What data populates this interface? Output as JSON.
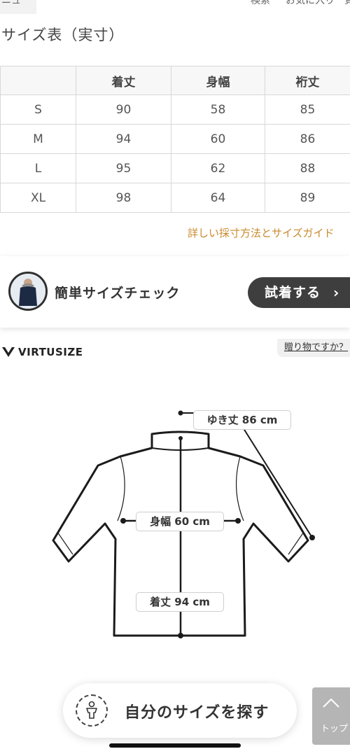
{
  "nav": {
    "left_tab": "ニュー",
    "search": "検索",
    "favorite": "お気に入り一覧"
  },
  "size_chart": {
    "title": "サイズ表（実寸）",
    "columns": [
      "",
      "着丈",
      "身幅",
      "裄丈"
    ],
    "rows": [
      [
        "S",
        "90",
        "58",
        "85"
      ],
      [
        "M",
        "94",
        "60",
        "86"
      ],
      [
        "L",
        "95",
        "62",
        "88"
      ],
      [
        "XL",
        "98",
        "64",
        "89"
      ]
    ],
    "guide_link": "詳しい採寸方法とサイズガイド"
  },
  "size_check": {
    "label": "簡単サイズチェック",
    "try_button": "試着する",
    "chevron": "›"
  },
  "gift_tab": "贈り物ですか？",
  "virtusize": {
    "logo_text": "VIRTUSIZE"
  },
  "diagram": {
    "sleeve_label": "ゆき丈 86 cm",
    "width_label": "身幅 60 cm",
    "length_label": "着丈 94 cm"
  },
  "find_size": {
    "label": "自分のサイズを探す"
  },
  "top_button": {
    "label": "トップ"
  }
}
